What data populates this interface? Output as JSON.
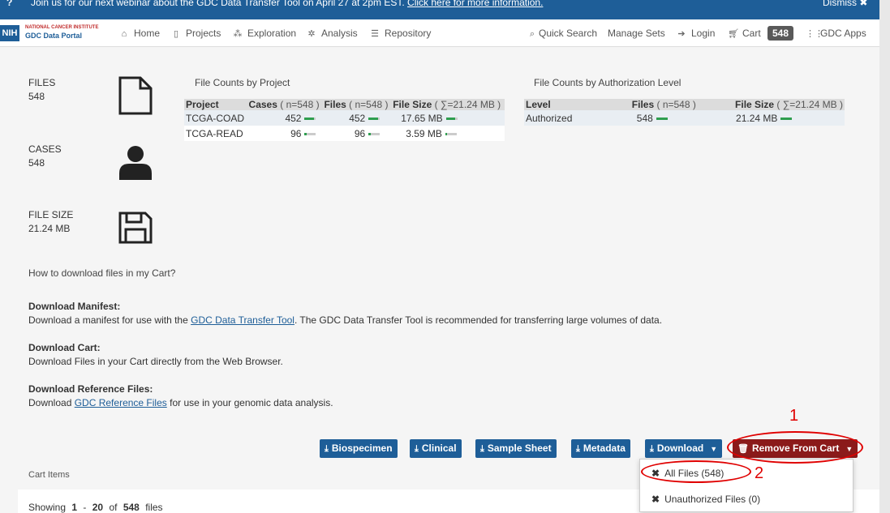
{
  "banner": {
    "question_icon": "?",
    "message_prefix": "Join us for our next webinar about the GDC Data Transfer Tool on April 27 at 2pm EST.",
    "message_link": "Click here for more information.",
    "dismiss": "Dismiss ✖"
  },
  "logo": {
    "nih": "NIH",
    "institute": "NATIONAL CANCER INSTITUTE",
    "portal": "GDC Data Portal"
  },
  "nav": {
    "home": "Home",
    "projects": "Projects",
    "exploration": "Exploration",
    "analysis": "Analysis",
    "repository": "Repository",
    "quick_search": "Quick Search",
    "manage_sets": "Manage Sets",
    "login": "Login",
    "cart": "Cart",
    "cart_count": "548",
    "gdc_apps": "GDC Apps"
  },
  "stats": {
    "files_label": "FILES",
    "files_value": "548",
    "cases_label": "CASES",
    "cases_value": "548",
    "size_label": "FILE SIZE",
    "size_value": "21.24 MB"
  },
  "project_table": {
    "title": "File Counts by Project",
    "headers": {
      "project": "Project",
      "cases": "Cases",
      "cases_n": "( n=548 )",
      "files": "Files",
      "files_n": "( n=548 )",
      "size": "File Size",
      "size_n": "( ∑=21.24 MB )"
    },
    "rows": [
      {
        "project": "TCGA-COAD",
        "cases": "452",
        "files": "452",
        "size": "17.65 MB",
        "cases_frac": 0.82,
        "files_frac": 0.82,
        "size_frac": 0.83
      },
      {
        "project": "TCGA-READ",
        "cases": "96",
        "files": "96",
        "size": "3.59 MB",
        "cases_frac": 0.18,
        "files_frac": 0.18,
        "size_frac": 0.17
      }
    ]
  },
  "auth_table": {
    "title": "File Counts by Authorization Level",
    "headers": {
      "level": "Level",
      "files": "Files",
      "files_n": "( n=548 )",
      "size": "File Size",
      "size_n": "( ∑=21.24 MB )"
    },
    "rows": [
      {
        "level": "Authorized",
        "files": "548",
        "size": "21.24 MB",
        "files_frac": 1.0,
        "size_frac": 1.0
      }
    ]
  },
  "help": {
    "question": "How to download files in my Cart?",
    "manifest_title": "Download Manifest:",
    "manifest_pre": "Download a manifest for use with the",
    "manifest_link": "GDC Data Transfer Tool",
    "manifest_post": ". The GDC Data Transfer Tool is recommended for transferring large volumes of data.",
    "cart_title": "Download Cart:",
    "cart_text": "Download Files in your Cart directly from the Web Browser.",
    "ref_title": "Download Reference Files:",
    "ref_pre": "Download",
    "ref_link": "GDC Reference Files",
    "ref_post": "for use in your genomic data analysis."
  },
  "buttons": {
    "biospecimen": "Biospecimen",
    "clinical": "Clinical",
    "sample_sheet": "Sample Sheet",
    "metadata": "Metadata",
    "download": "Download",
    "remove": "Remove From Cart"
  },
  "dropdown": {
    "all_files": "All Files (548)",
    "unauthorized": "Unauthorized Files (0)"
  },
  "cart_items": {
    "label": "Cart Items",
    "showing_prefix": "Showing",
    "from": "1",
    "dash": "-",
    "to": "20",
    "of": "of",
    "total": "548",
    "suffix": "files"
  },
  "annotations": {
    "one": "1",
    "two": "2"
  },
  "colors": {
    "primary": "#1e5e98",
    "danger": "#8b1a1a",
    "bar_fill": "#2e9e4f",
    "annotation": "#e00000"
  }
}
